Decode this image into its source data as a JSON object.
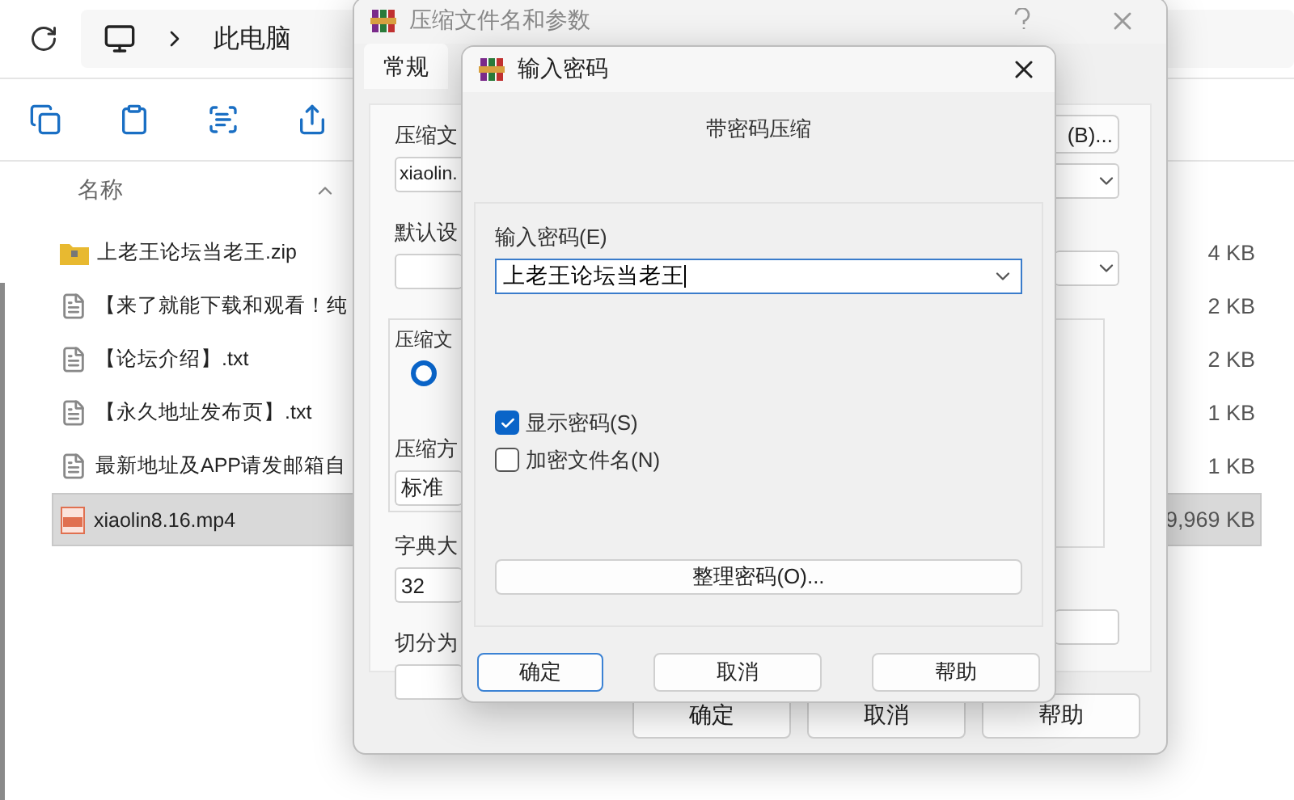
{
  "explorer": {
    "breadcrumb": [
      "此电脑"
    ],
    "column_header": "名称",
    "files": [
      {
        "name": "上老王论坛当老王.zip",
        "size": "4 KB",
        "kind": "zip",
        "selected": false
      },
      {
        "name": "【来了就能下载和观看！纯",
        "size": "2 KB",
        "kind": "txt",
        "selected": false
      },
      {
        "name": "【论坛介绍】.txt",
        "size": "2 KB",
        "kind": "txt",
        "selected": false
      },
      {
        "name": "【永久地址发布页】.txt",
        "size": "1 KB",
        "kind": "txt",
        "selected": false
      },
      {
        "name": "最新地址及APP请发邮箱自",
        "size": "1 KB",
        "kind": "txt",
        "selected": false
      },
      {
        "name": "xiaolin8.16.mp4",
        "size": "9,969 KB",
        "kind": "mp4",
        "selected": true
      }
    ]
  },
  "compress_dialog": {
    "title": "压缩文件名和参数",
    "tabs": [
      {
        "label": "常规",
        "selected": true
      }
    ],
    "archive_name_label": "压缩文",
    "archive_name_value": "xiaolin.",
    "browse_button": "(B)...",
    "profile_label": "默认设",
    "group_label": "压缩文",
    "radio_selected": true,
    "method_label": "压缩方",
    "method_value": "标准",
    "dict_label": "字典大",
    "dict_value": "32",
    "split_label": "切分为",
    "buttons": [
      "确定",
      "取消",
      "帮助"
    ]
  },
  "password_dialog": {
    "title": "输入密码",
    "heading": "带密码压缩",
    "password_label": "输入密码(E)",
    "password_value": "上老王论坛当老王",
    "options": [
      {
        "label": "显示密码(S)",
        "checked": true
      },
      {
        "label": "加密文件名(N)",
        "checked": false
      }
    ],
    "organize_button": "整理密码(O)...",
    "buttons": [
      {
        "label": "确定",
        "default": true
      },
      {
        "label": "取消",
        "default": false
      },
      {
        "label": "帮助",
        "default": false
      }
    ]
  }
}
